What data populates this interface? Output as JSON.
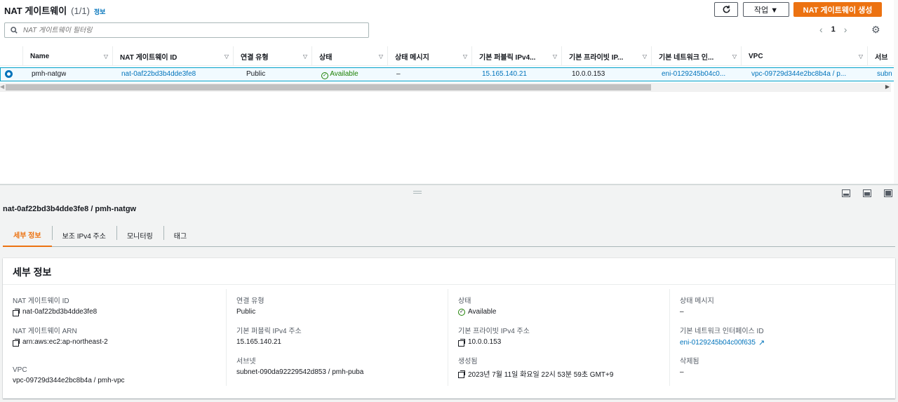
{
  "header": {
    "title": "NAT 게이트웨이",
    "count": "(1/1)",
    "info": "정보",
    "refresh_icon": "refresh-icon",
    "actions_label": "작업 ▼",
    "create_label": "NAT 게이트웨이 생성"
  },
  "filter": {
    "placeholder": "NAT 게이트웨이 필터링"
  },
  "pagination": {
    "prev": "‹",
    "page": "1",
    "next": "›"
  },
  "table": {
    "columns": [
      "Name",
      "NAT 게이트웨이 ID",
      "연결 유형",
      "상태",
      "상태 메시지",
      "기본 퍼블릭 IPv4...",
      "기본 프라이빗 IP...",
      "기본 네트워크 인...",
      "VPC",
      "서브"
    ],
    "rows": [
      {
        "name": "pmh-natgw",
        "id": "nat-0af22bd3b4dde3fe8",
        "type": "Public",
        "status": "Available",
        "status_msg": "–",
        "public_ip": "15.165.140.21",
        "private_ip": "10.0.0.153",
        "eni": "eni-0129245b04c0...",
        "vpc": "vpc-09729d344e2bc8b4a / p...",
        "subnet": "subn"
      }
    ]
  },
  "detail": {
    "title": "nat-0af22bd3b4dde3fe8 / pmh-natgw",
    "tabs": [
      "세부 정보",
      "보조 IPv4 주소",
      "모니터링",
      "태그"
    ],
    "panel_title": "세부 정보",
    "fields": {
      "nat_id_label": "NAT 게이트웨이 ID",
      "nat_id": "nat-0af22bd3b4dde3fe8",
      "arn_label": "NAT 게이트웨이 ARN",
      "arn": "arn:aws:ec2:ap-northeast-2",
      "vpc_label": "VPC",
      "vpc": "vpc-09729d344e2bc8b4a / pmh-vpc",
      "type_label": "연결 유형",
      "type": "Public",
      "public_ip_label": "기본 퍼블릭 IPv4 주소",
      "public_ip": "15.165.140.21",
      "subnet_label": "서브넷",
      "subnet": "subnet-090da92229542d853 / pmh-puba",
      "status_label": "상태",
      "status": "Available",
      "private_ip_label": "기본 프라이빗 IPv4 주소",
      "private_ip": "10.0.0.153",
      "created_label": "생성됨",
      "created": "2023년 7월 11일 화요일 22시 53분 59초 GMT+9",
      "status_msg_label": "상태 메시지",
      "status_msg": "–",
      "eni_label": "기본 네트워크 인터페이스 ID",
      "eni": "eni-0129245b04c00f635",
      "deleted_label": "삭제됨",
      "deleted": "–"
    }
  },
  "colors": {
    "accent": "#ec7211",
    "link": "#0073bb",
    "success": "#1d8102"
  }
}
